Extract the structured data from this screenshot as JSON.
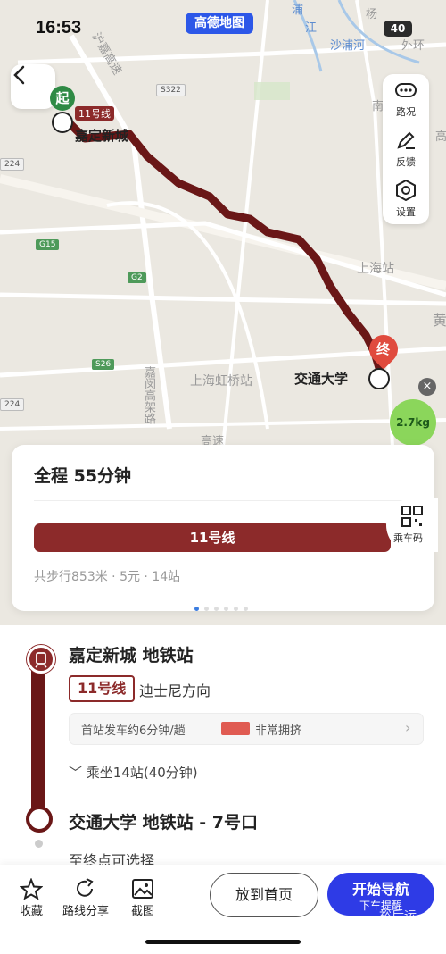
{
  "status_bar": {
    "time": "16:53",
    "app_badge": "高德地图",
    "battery": "40"
  },
  "map": {
    "labels": {
      "start_marker": "起",
      "end_marker": "终",
      "start_line": "11号线",
      "start_station": "嘉定新城",
      "end_station": "交通大学",
      "hongqiao": "上海虹桥站",
      "shanghai_station": "上海站",
      "shapu": "沙浦河",
      "waihuan": "外环",
      "gao": "高",
      "huang": "黄",
      "nan": "南",
      "hu_jia": "沪嘉高速",
      "jiamin": "嘉闵高架路",
      "gaosu": "高速",
      "pu": "浦",
      "jiang": "江",
      "yang": "杨"
    },
    "shields": [
      "S322",
      "224",
      "G15",
      "G2",
      "S26",
      "224",
      "G"
    ],
    "tools": [
      {
        "label": "路况",
        "icon": "traffic-icon"
      },
      {
        "label": "反馈",
        "icon": "feedback-pen-icon"
      },
      {
        "label": "设置",
        "icon": "settings-icon"
      }
    ],
    "carbon": "2.7kg",
    "close": "×",
    "route_color": "#6a1717"
  },
  "summary": {
    "title": "全程  55分钟",
    "line_bar": "11号线",
    "qr_label": "乘车码",
    "sub": "共步行853米 · 5元 · 14站",
    "pages": 6,
    "active_page": 0
  },
  "detail": {
    "start_station": "嘉定新城 地铁站",
    "line_badge": "11号线",
    "direction": "迪士尼方向",
    "info_text": "首站发车约6分钟/趟",
    "crowd_text": "非常拥挤",
    "chevron": "›",
    "ride": "﹀ 乘坐14站(40分钟)",
    "end_station": "交通大学 地铁站 - 7号口",
    "end_sub": "至终点可选择",
    "line_color": "#8c2a2a"
  },
  "bottom_bar": {
    "favorite": "收藏",
    "share": "路线分享",
    "screenshot": "截图",
    "home_button": "放到首页",
    "nav_main": "开始导航",
    "nav_sub": "下车提醒",
    "watermark": "裕后运",
    "nav_color": "#2e3be6"
  }
}
